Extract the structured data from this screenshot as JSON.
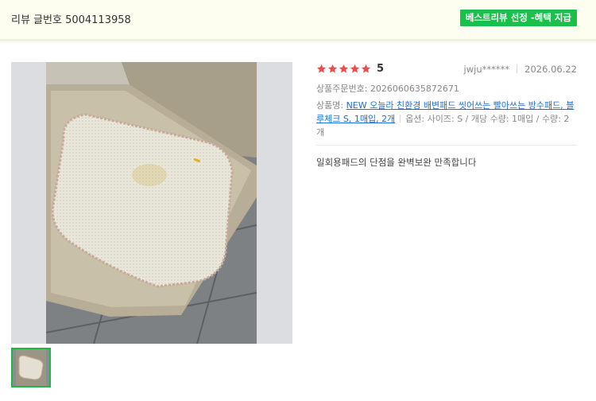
{
  "header": {
    "review_label": "리뷰 글번호 5004113958",
    "best_badge": "베스트리뷰 선정 -혜택 지급"
  },
  "review": {
    "rating": 5,
    "rating_text": "5",
    "user": "jwju******",
    "date": "2026.06.22",
    "order_number": "상품주문번호: 2026060635872671",
    "product_label": "상품명:",
    "product_name": "NEW 오늘라 친환경 배변패드 씻어쓰는 빨아쓰는 방수패드, 블루체크 S, 1매입, 2개",
    "option": "옵션: 사이즈: S / 개당 수량: 1매입 / 수량: 2개",
    "text": "일회용패드의 단점을 완벽보완 만족합니다"
  },
  "colors": {
    "star": "#f04b4b",
    "badge": "#19c04a",
    "link": "#1a70d8",
    "header_bg": "#fdfdf0"
  },
  "icons": {
    "star": "star-icon"
  }
}
